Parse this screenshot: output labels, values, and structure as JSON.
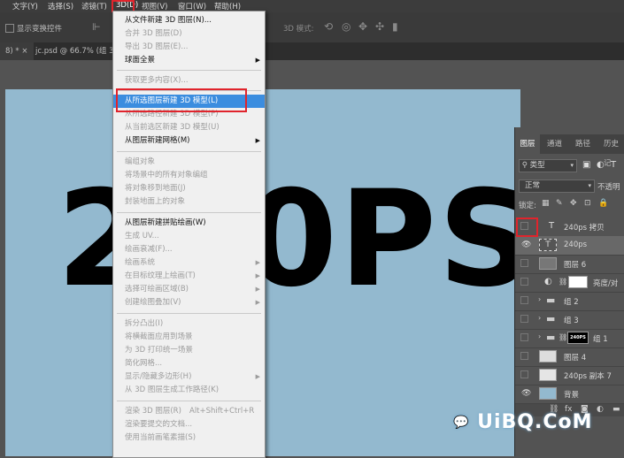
{
  "menubar": [
    "文字(Y)",
    "选择(S)",
    "滤镜(T)",
    "3D(D)",
    "视图(V)",
    "窗口(W)",
    "帮助(H)"
  ],
  "options": {
    "show_transform": "显示变换控件",
    "mode_3d": "3D 模式:"
  },
  "tabs": [
    "8) * ×",
    "jc.psd @ 66.7% (组 3..."
  ],
  "canvas_text": "240PS",
  "menu": {
    "items": [
      "从文件新建 3D 图层(N)...",
      "合并 3D 图层(D)",
      "导出 3D 图层(E)...",
      "球面全景",
      "获取更多内容(X)...",
      "从所选图层新建 3D 模型(L)",
      "从所选路径新建 3D 模型(P)",
      "从当前选区新建 3D 模型(U)",
      "从图层新建网格(M)",
      "编组对象",
      "将场景中的所有对象编组",
      "将对象移到地面(J)",
      "封装地面上的对象",
      "从图层新建拼贴绘画(W)",
      "生成 UV...",
      "绘画衰减(F)...",
      "绘画系统",
      "在目标纹理上绘画(T)",
      "选择可绘画区域(B)",
      "创建绘图叠加(V)",
      "拆分凸出(I)",
      "将横截面应用到场景",
      "为 3D 打印统一场景",
      "简化网格...",
      "显示/隐藏多边形(H)",
      "从 3D 图层生成工作路径(K)",
      "渲染 3D 图层(R)",
      "渲染要提交的文档...",
      "使用当前画笔素描(S)"
    ],
    "shortcut": "Alt+Shift+Ctrl+R"
  },
  "panel": {
    "tabs": [
      "图层",
      "通道",
      "路径",
      "历史记"
    ],
    "filter": "类型",
    "blend": "正常",
    "opacity": "不透明",
    "lock": "锁定:",
    "layers": [
      {
        "name": "240ps 拷贝",
        "kind": "T"
      },
      {
        "name": "240ps",
        "kind": "T"
      },
      {
        "name": "图层 6",
        "kind": "img"
      },
      {
        "name": "亮度/对",
        "kind": "adj"
      },
      {
        "name": "组 2",
        "kind": "group"
      },
      {
        "name": "组 3",
        "kind": "group"
      },
      {
        "name": "组 1",
        "kind": "group"
      },
      {
        "name": "图层 4",
        "kind": "img"
      },
      {
        "name": "240ps 副本 7",
        "kind": "img"
      },
      {
        "name": "背景",
        "kind": "img"
      }
    ],
    "thumb_text": "240PS"
  },
  "watermark": "UiBQ.CoM"
}
